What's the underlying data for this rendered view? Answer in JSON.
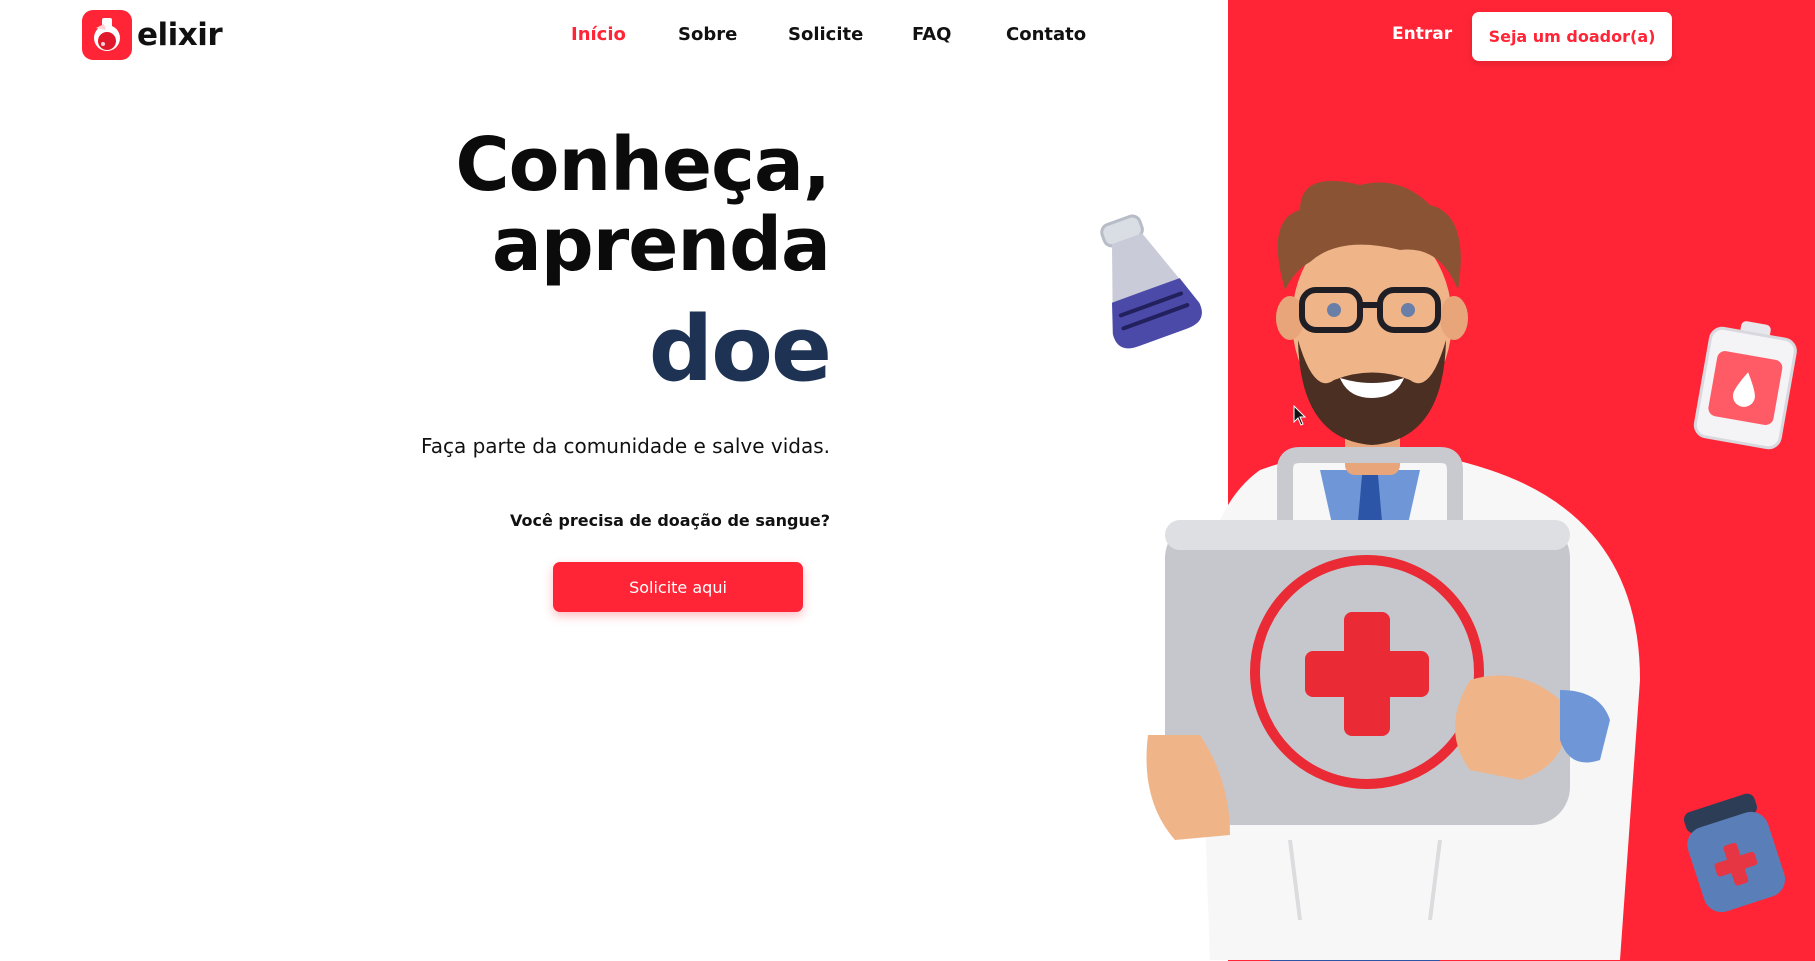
{
  "brand": {
    "name": "elixir",
    "color": "#ff2536",
    "accent_dark": "#1e3354"
  },
  "nav": {
    "items": [
      {
        "label": "Início",
        "active": true
      },
      {
        "label": "Sobre",
        "active": false
      },
      {
        "label": "Solicite",
        "active": false
      },
      {
        "label": "FAQ",
        "active": false
      },
      {
        "label": "Contato",
        "active": false
      }
    ]
  },
  "header": {
    "login_label": "Entrar",
    "donor_button_label": "Seja um doador(a)"
  },
  "hero": {
    "title_line1": "Conheça,",
    "title_line2": "aprenda",
    "title_accent": "doe",
    "subtitle": "Faça parte da comunidade e salve vidas.",
    "question": "Você precisa de doação de sangue?",
    "cta_label": "Solicite aqui"
  },
  "illustration": {
    "main": "doctor-with-first-aid-kit-illustration",
    "floating": [
      "flask-icon",
      "blood-bag-icon",
      "medicine-jar-icon"
    ]
  }
}
